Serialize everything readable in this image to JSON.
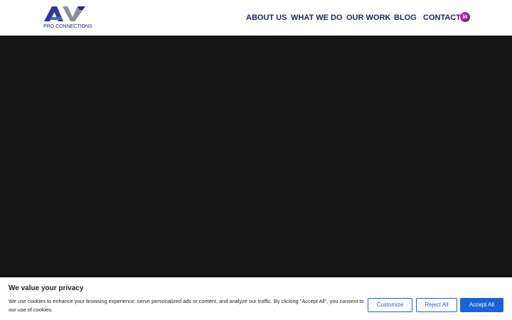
{
  "brand": {
    "logo_text": "PRO CONNECTIONS",
    "logo_colors": [
      "#2e3a9a",
      "#3b6fd1",
      "#8a8f98"
    ]
  },
  "nav": {
    "items": [
      {
        "label": "ABOUT US"
      },
      {
        "label": "WHAT WE DO"
      },
      {
        "label": "OUR WORK"
      },
      {
        "label": "BLOG"
      },
      {
        "label": "CONTACT"
      }
    ],
    "social_icon": "linkedin-icon",
    "social_text": "in"
  },
  "hero": {
    "background": "#151515"
  },
  "cookie": {
    "title": "We value your privacy",
    "message": "We use cookies to enhance your browsing experience, serve personalized ads or content, and analyze our traffic. By clicking \"Accept All\", you consent to our use of cookies.",
    "buttons": {
      "customize": "Customize",
      "reject": "Reject All",
      "accept": "Accept All"
    },
    "accent": "#1863dc"
  }
}
